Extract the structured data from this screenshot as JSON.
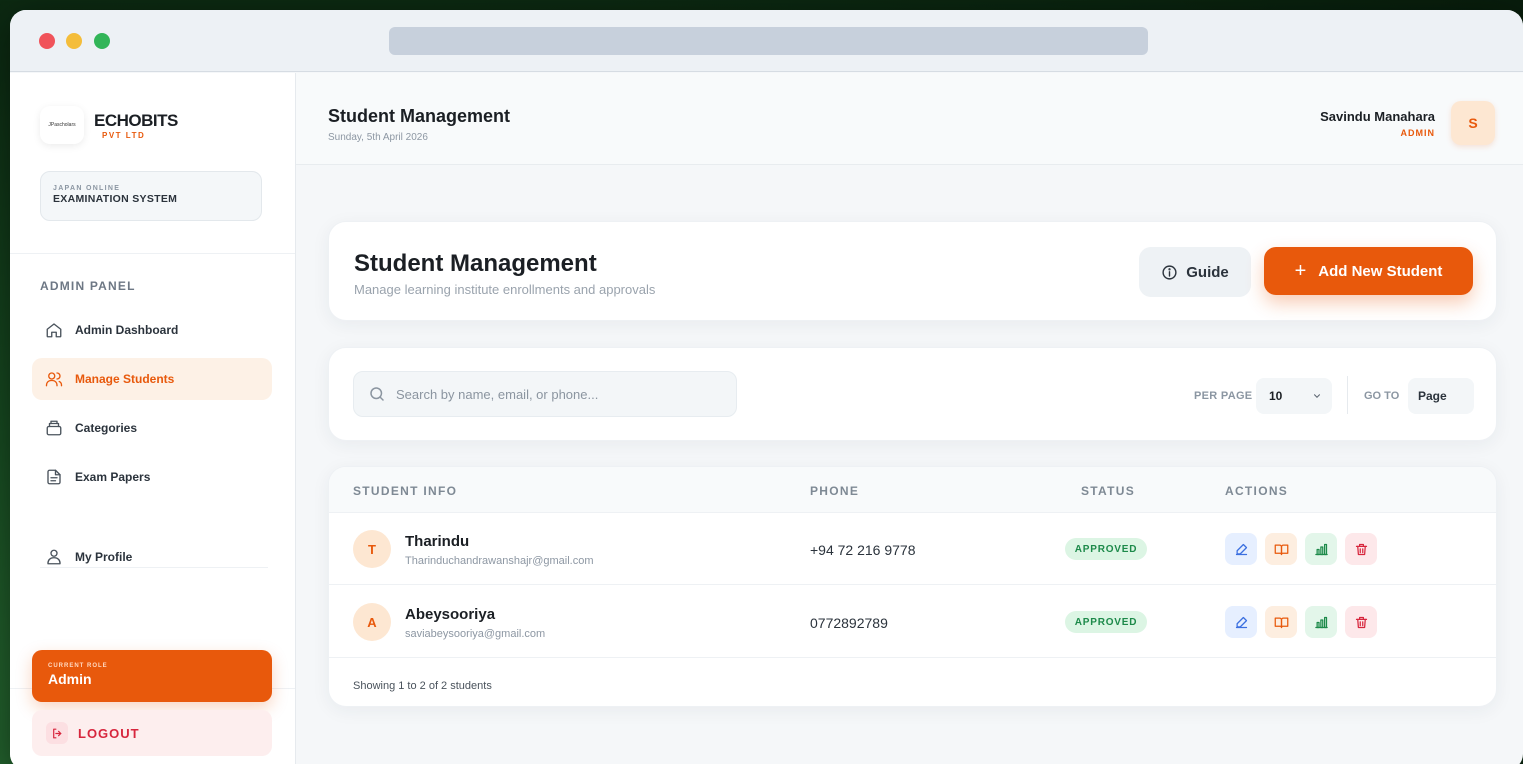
{
  "brand": {
    "name": "ECHOBITS",
    "sub": "PVT LTD",
    "logo_text": "JPascholars"
  },
  "system": {
    "small": "JAPAN ONLINE",
    "big": "EXAMINATION SYSTEM"
  },
  "sidebar": {
    "panel_label": "ADMIN PANEL",
    "items": [
      {
        "label": "Admin Dashboard",
        "icon": "home-icon"
      },
      {
        "label": "Manage Students",
        "icon": "users-icon",
        "active": true
      },
      {
        "label": "Categories",
        "icon": "layers-icon"
      },
      {
        "label": "Exam Papers",
        "icon": "document-icon"
      },
      {
        "label": "My Profile",
        "icon": "user-icon"
      }
    ],
    "role_label": "CURRENT ROLE",
    "role_value": "Admin",
    "logout_label": "LOGOUT"
  },
  "topbar": {
    "title": "Student Management",
    "date": "Sunday, 5th April 2026",
    "user_name": "Savindu Manahara",
    "user_role": "ADMIN",
    "avatar_initial": "S"
  },
  "header": {
    "title": "Student Management",
    "subtitle": "Manage learning institute enrollments and approvals",
    "guide_label": "Guide",
    "add_label": "Add New Student"
  },
  "filters": {
    "search_placeholder": "Search by name, email, or phone...",
    "per_page_label": "PER PAGE",
    "per_page_value": "10",
    "goto_label": "GO TO",
    "goto_placeholder": "Page"
  },
  "table": {
    "columns": [
      "STUDENT INFO",
      "PHONE",
      "STATUS",
      "ACTIONS"
    ],
    "rows": [
      {
        "initial": "T",
        "name": "Tharindu",
        "email": "Tharinduchandrawanshajr@gmail.com",
        "phone": "+94 72 216 9778",
        "status": "APPROVED"
      },
      {
        "initial": "A",
        "name": "Abeysooriya",
        "email": "saviabeysooriya@gmail.com",
        "phone": "0772892789",
        "status": "APPROVED"
      }
    ],
    "footer": "Showing 1 to 2 of 2 students"
  },
  "colors": {
    "accent": "#e8590c",
    "approved_bg": "#dcf5e4",
    "approved_text": "#1d8a4a"
  }
}
